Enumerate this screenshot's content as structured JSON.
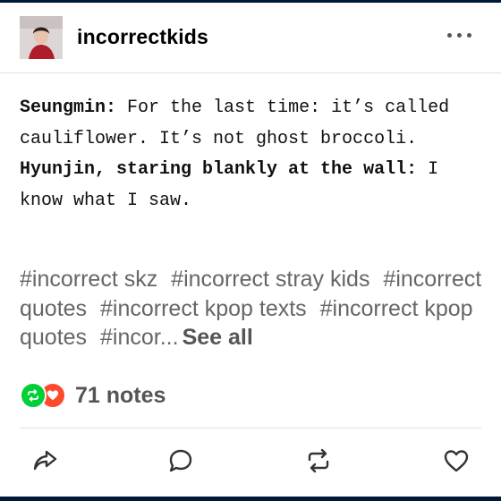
{
  "header": {
    "blog_name": "incorrectkids",
    "avatar_icon": "user-avatar",
    "menu_icon": "more-options-icon"
  },
  "post": {
    "lines": [
      {
        "speaker": "Seungmin:",
        "text": " For the last time: it’s called cauliflower. It’s not ghost broccoli."
      },
      {
        "speaker": "Hyunjin, staring blankly at the wall:",
        "text": " I know what I saw."
      }
    ]
  },
  "tags": {
    "items": [
      "#incorrect skz",
      "#incorrect stray kids",
      "#incorrect quotes",
      "#incorrect kpop texts",
      "#incorrect kpop quotes",
      "#incor..."
    ],
    "see_all": "See all"
  },
  "notes": {
    "label": "71 notes",
    "reblog_color": "#00cf35",
    "like_color": "#ff492f"
  },
  "actions": {
    "share_icon": "share-icon",
    "reply_icon": "reply-icon",
    "reblog_icon": "reblog-icon",
    "like_icon": "heart-icon"
  }
}
